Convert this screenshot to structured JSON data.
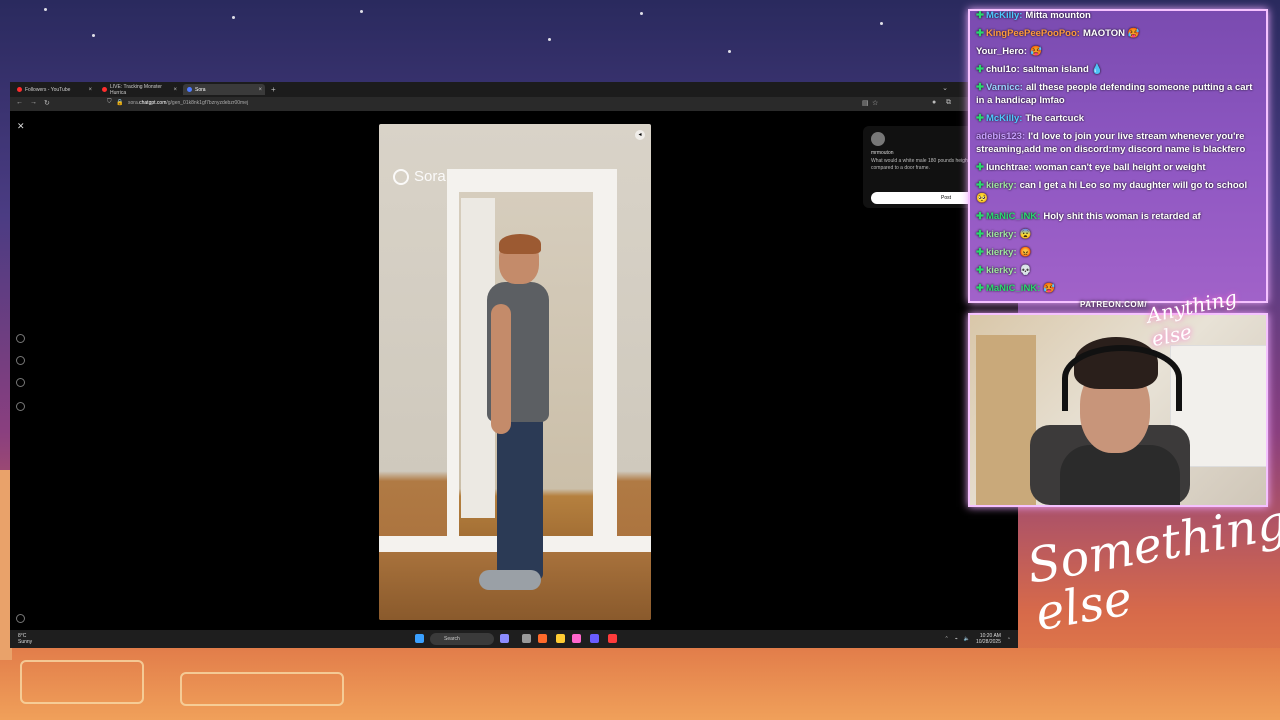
{
  "browser": {
    "tabs": [
      {
        "label": "Followers - YouTube"
      },
      {
        "label": "LIVE: Tracking Monster Hurrica"
      },
      {
        "label": "Sora"
      }
    ],
    "url_prefix": "sora.",
    "url_domain": "chatgpt.com",
    "url_path": "/g/gen_01k8nk1gf7bznyzdebzr00mej"
  },
  "video": {
    "watermark": "Sora"
  },
  "prompt_card": {
    "username": "mrmouton",
    "prompt": "What would a white male 180 pounds height of 5'2 look like compared to a door frame.",
    "post_label": "Post"
  },
  "taskbar": {
    "weather_temp": "8°C",
    "weather_desc": "Sunny",
    "search_label": "Search",
    "time": "10:20 AM",
    "date": "10/28/2025"
  },
  "chat": {
    "messages": [
      {
        "user": "McKilly:",
        "color": "#4ec9ff",
        "text": "Mitta mounton"
      },
      {
        "user": "KingPeePeePooPoo:",
        "color": "#ff9a3c",
        "text": "MAOTON 🥵"
      },
      {
        "user": "Your_Hero:",
        "color": "#ffffff",
        "text": "🥵"
      },
      {
        "user": "chul1o:",
        "color": "#ffffff",
        "text": "saltman island 💧"
      },
      {
        "user": "Varnicc:",
        "color": "#9ad2ff",
        "text": "all these people defending someone putting a cart in a handicap lmfao"
      },
      {
        "user": "McKilly:",
        "color": "#4ec9ff",
        "text": "The cartcuck"
      },
      {
        "user": "adebis123:",
        "color": "#c8a0ff",
        "text": "I'd love to join your live stream whenever you're streaming,add me on discord:my discord name is blackfero"
      },
      {
        "user": "lunchtrae:",
        "color": "#ffffff",
        "text": "woman can't eye ball height or weight"
      },
      {
        "user": "kierky:",
        "color": "#a0e7a0",
        "text": "can I get a hi Leo so my daughter will go to school 🥺"
      },
      {
        "user": "MaNiC_iNK:",
        "color": "#2bd96f",
        "text": "Holy shit this woman is retarded af"
      },
      {
        "user": "kierky:",
        "color": "#a0e7a0",
        "text": "😨"
      },
      {
        "user": "kierky:",
        "color": "#a0e7a0",
        "text": "😡"
      },
      {
        "user": "kierky:",
        "color": "#a0e7a0",
        "text": "💀"
      },
      {
        "user": "MaNiC_iNK:",
        "color": "#2bd96f",
        "text": "🥵"
      }
    ]
  },
  "overlay": {
    "patreon": "PATREON.COM/",
    "brand_small": "Anything else",
    "brand_large": "Something else"
  }
}
